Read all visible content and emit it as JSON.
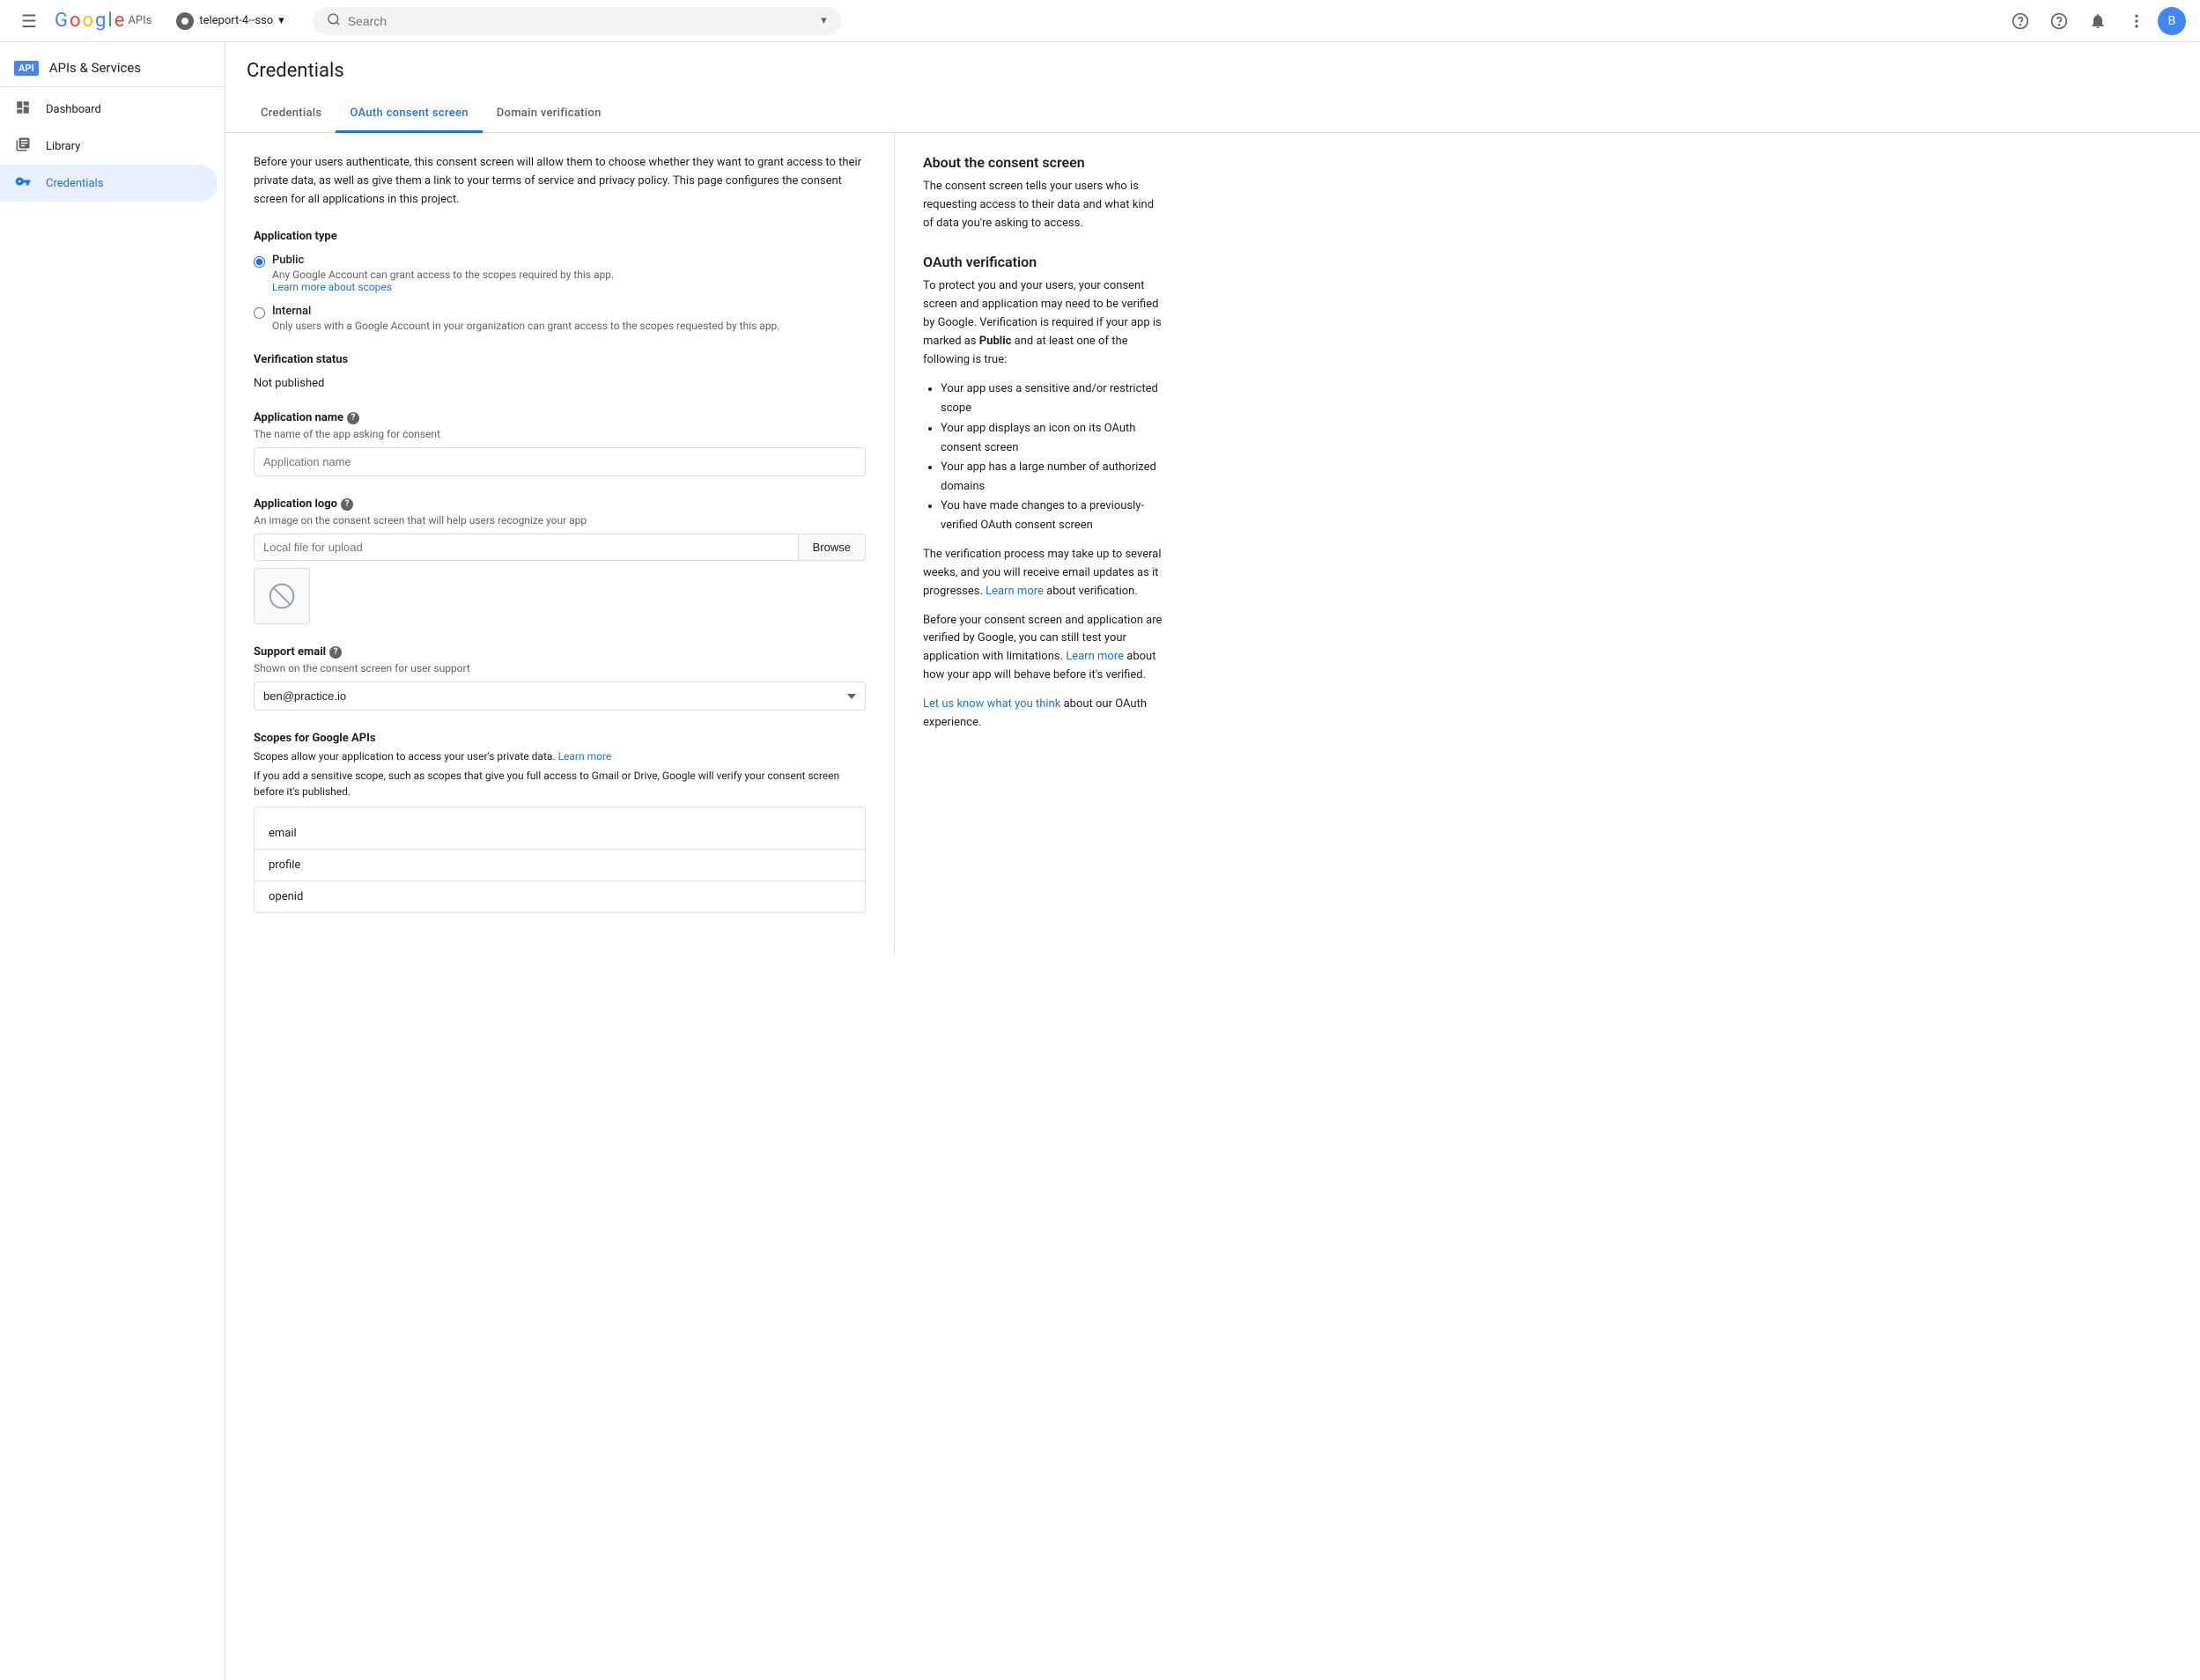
{
  "topbar": {
    "hamburger_icon": "☰",
    "google_text": "Google",
    "apis_text": "APIs",
    "project_name": "teleport-4--sso",
    "search_placeholder": "Search",
    "dropdown_icon": "▾",
    "help_icon": "?",
    "notification_icon": "🔔",
    "more_icon": "⋮",
    "avatar_letter": "B"
  },
  "sidebar": {
    "api_badge": "API",
    "title": "APIs & Services",
    "items": [
      {
        "id": "dashboard",
        "label": "Dashboard",
        "icon": "⊞"
      },
      {
        "id": "library",
        "label": "Library",
        "icon": "▦"
      },
      {
        "id": "credentials",
        "label": "Credentials",
        "icon": "🔑",
        "active": true
      }
    ]
  },
  "page": {
    "title": "Credentials",
    "tabs": [
      {
        "id": "credentials",
        "label": "Credentials",
        "active": false
      },
      {
        "id": "oauth",
        "label": "OAuth consent screen",
        "active": true
      },
      {
        "id": "domain",
        "label": "Domain verification",
        "active": false
      }
    ]
  },
  "main": {
    "intro": "Before your users authenticate, this consent screen will allow them to choose whether they want to grant access to their private data, as well as give them a link to your terms of service and privacy policy. This page configures the consent screen for all applications in this project.",
    "app_type_label": "Application type",
    "radio_public": {
      "label": "Public",
      "desc": "Any Google Account can grant access to the scopes required by this app.",
      "link_text": "Learn more about scopes",
      "checked": true
    },
    "radio_internal": {
      "label": "Internal",
      "desc": "Only users with a Google Account in your organization can grant access to the scopes requested by this app.",
      "checked": false
    },
    "verification_label": "Verification status",
    "verification_value": "Not published",
    "app_name_label": "Application name",
    "app_name_help": "?",
    "app_name_hint": "The name of the app asking for consent",
    "app_name_placeholder": "Application name",
    "app_logo_label": "Application logo",
    "app_logo_help": "?",
    "app_logo_hint": "An image on the consent screen that will help users recognize your app",
    "logo_file_placeholder": "Local file for upload",
    "browse_btn": "Browse",
    "support_email_label": "Support email",
    "support_email_help": "?",
    "support_email_hint": "Shown on the consent screen for user support",
    "support_email_value": "ben@practice.io",
    "scopes_label": "Scopes for Google APIs",
    "scopes_desc1": "Scopes allow your application to access your user's private data.",
    "scopes_learn_more": "Learn more",
    "scopes_desc2": "If you add a sensitive scope, such as scopes that give you full access to Gmail or Drive, Google will verify your consent screen before it's published.",
    "scopes": [
      {
        "name": "email"
      },
      {
        "name": "profile"
      },
      {
        "name": "openid"
      }
    ]
  },
  "right": {
    "consent_title": "About the consent screen",
    "consent_text": "The consent screen tells your users who is requesting access to their data and what kind of data you're asking to access.",
    "oauth_title": "OAuth verification",
    "oauth_intro": "To protect you and your users, your consent screen and application may need to be verified by Google. Verification is required if your app is marked as ",
    "public_bold": "Public",
    "oauth_mid": " and at least one of the following is true:",
    "bullets": [
      "Your app uses a sensitive and/or restricted scope",
      "Your app displays an icon on its OAuth consent screen",
      "Your app has a large number of authorized domains",
      "You have made changes to a previously-verified OAuth consent screen"
    ],
    "verification_para1_before": "The verification process may take up to several weeks, and you will receive email updates as it progresses. ",
    "verification_para1_link": "Learn more",
    "verification_para1_after": " about verification.",
    "verification_para2_before": "Before your consent screen and application are verified by Google, you can still test your application with limitations. ",
    "verification_para2_link": "Learn more",
    "verification_para2_after": " about how your app will behave before it's verified.",
    "feedback_link": "Let us know what you think",
    "feedback_after": " about our OAuth experience."
  }
}
